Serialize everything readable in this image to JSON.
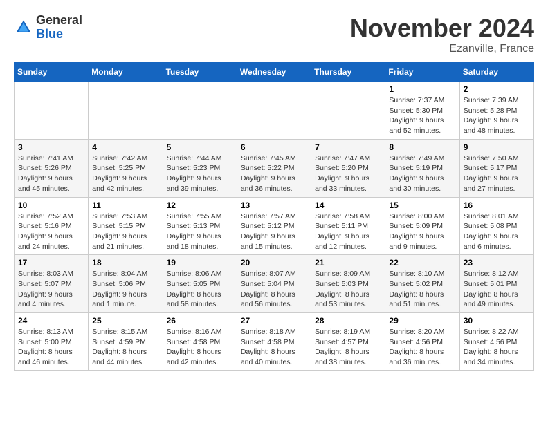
{
  "logo": {
    "general": "General",
    "blue": "Blue"
  },
  "title": "November 2024",
  "location": "Ezanville, France",
  "days_header": [
    "Sunday",
    "Monday",
    "Tuesday",
    "Wednesday",
    "Thursday",
    "Friday",
    "Saturday"
  ],
  "weeks": [
    [
      {
        "day": "",
        "info": ""
      },
      {
        "day": "",
        "info": ""
      },
      {
        "day": "",
        "info": ""
      },
      {
        "day": "",
        "info": ""
      },
      {
        "day": "",
        "info": ""
      },
      {
        "day": "1",
        "info": "Sunrise: 7:37 AM\nSunset: 5:30 PM\nDaylight: 9 hours\nand 52 minutes."
      },
      {
        "day": "2",
        "info": "Sunrise: 7:39 AM\nSunset: 5:28 PM\nDaylight: 9 hours\nand 48 minutes."
      }
    ],
    [
      {
        "day": "3",
        "info": "Sunrise: 7:41 AM\nSunset: 5:26 PM\nDaylight: 9 hours\nand 45 minutes."
      },
      {
        "day": "4",
        "info": "Sunrise: 7:42 AM\nSunset: 5:25 PM\nDaylight: 9 hours\nand 42 minutes."
      },
      {
        "day": "5",
        "info": "Sunrise: 7:44 AM\nSunset: 5:23 PM\nDaylight: 9 hours\nand 39 minutes."
      },
      {
        "day": "6",
        "info": "Sunrise: 7:45 AM\nSunset: 5:22 PM\nDaylight: 9 hours\nand 36 minutes."
      },
      {
        "day": "7",
        "info": "Sunrise: 7:47 AM\nSunset: 5:20 PM\nDaylight: 9 hours\nand 33 minutes."
      },
      {
        "day": "8",
        "info": "Sunrise: 7:49 AM\nSunset: 5:19 PM\nDaylight: 9 hours\nand 30 minutes."
      },
      {
        "day": "9",
        "info": "Sunrise: 7:50 AM\nSunset: 5:17 PM\nDaylight: 9 hours\nand 27 minutes."
      }
    ],
    [
      {
        "day": "10",
        "info": "Sunrise: 7:52 AM\nSunset: 5:16 PM\nDaylight: 9 hours\nand 24 minutes."
      },
      {
        "day": "11",
        "info": "Sunrise: 7:53 AM\nSunset: 5:15 PM\nDaylight: 9 hours\nand 21 minutes."
      },
      {
        "day": "12",
        "info": "Sunrise: 7:55 AM\nSunset: 5:13 PM\nDaylight: 9 hours\nand 18 minutes."
      },
      {
        "day": "13",
        "info": "Sunrise: 7:57 AM\nSunset: 5:12 PM\nDaylight: 9 hours\nand 15 minutes."
      },
      {
        "day": "14",
        "info": "Sunrise: 7:58 AM\nSunset: 5:11 PM\nDaylight: 9 hours\nand 12 minutes."
      },
      {
        "day": "15",
        "info": "Sunrise: 8:00 AM\nSunset: 5:09 PM\nDaylight: 9 hours\nand 9 minutes."
      },
      {
        "day": "16",
        "info": "Sunrise: 8:01 AM\nSunset: 5:08 PM\nDaylight: 9 hours\nand 6 minutes."
      }
    ],
    [
      {
        "day": "17",
        "info": "Sunrise: 8:03 AM\nSunset: 5:07 PM\nDaylight: 9 hours\nand 4 minutes."
      },
      {
        "day": "18",
        "info": "Sunrise: 8:04 AM\nSunset: 5:06 PM\nDaylight: 9 hours\nand 1 minute."
      },
      {
        "day": "19",
        "info": "Sunrise: 8:06 AM\nSunset: 5:05 PM\nDaylight: 8 hours\nand 58 minutes."
      },
      {
        "day": "20",
        "info": "Sunrise: 8:07 AM\nSunset: 5:04 PM\nDaylight: 8 hours\nand 56 minutes."
      },
      {
        "day": "21",
        "info": "Sunrise: 8:09 AM\nSunset: 5:03 PM\nDaylight: 8 hours\nand 53 minutes."
      },
      {
        "day": "22",
        "info": "Sunrise: 8:10 AM\nSunset: 5:02 PM\nDaylight: 8 hours\nand 51 minutes."
      },
      {
        "day": "23",
        "info": "Sunrise: 8:12 AM\nSunset: 5:01 PM\nDaylight: 8 hours\nand 49 minutes."
      }
    ],
    [
      {
        "day": "24",
        "info": "Sunrise: 8:13 AM\nSunset: 5:00 PM\nDaylight: 8 hours\nand 46 minutes."
      },
      {
        "day": "25",
        "info": "Sunrise: 8:15 AM\nSunset: 4:59 PM\nDaylight: 8 hours\nand 44 minutes."
      },
      {
        "day": "26",
        "info": "Sunrise: 8:16 AM\nSunset: 4:58 PM\nDaylight: 8 hours\nand 42 minutes."
      },
      {
        "day": "27",
        "info": "Sunrise: 8:18 AM\nSunset: 4:58 PM\nDaylight: 8 hours\nand 40 minutes."
      },
      {
        "day": "28",
        "info": "Sunrise: 8:19 AM\nSunset: 4:57 PM\nDaylight: 8 hours\nand 38 minutes."
      },
      {
        "day": "29",
        "info": "Sunrise: 8:20 AM\nSunset: 4:56 PM\nDaylight: 8 hours\nand 36 minutes."
      },
      {
        "day": "30",
        "info": "Sunrise: 8:22 AM\nSunset: 4:56 PM\nDaylight: 8 hours\nand 34 minutes."
      }
    ]
  ]
}
